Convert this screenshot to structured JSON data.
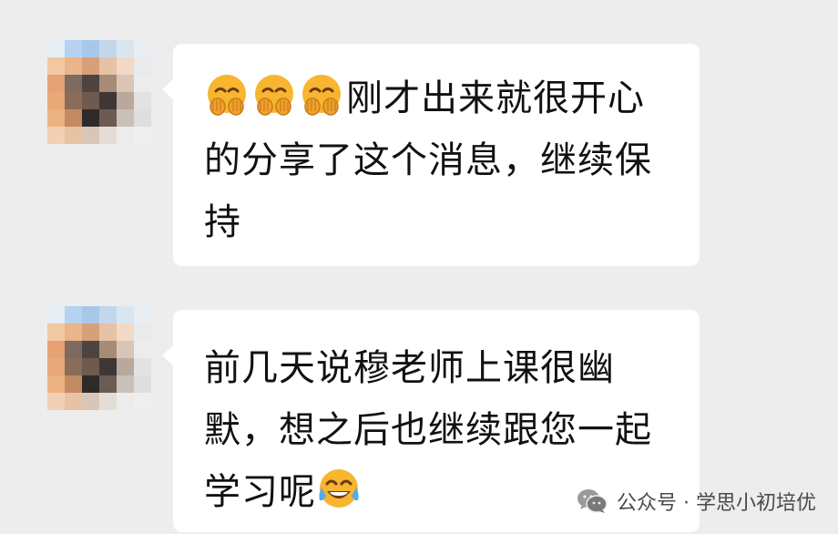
{
  "messages": [
    {
      "emojis": [
        "hands-over-mouth-emoji",
        "hands-over-mouth-emoji",
        "hands-over-mouth-emoji"
      ],
      "text": "刚才出来就很开心的分享了这个消息，继续保持"
    },
    {
      "text": "前几天说穆老师上课很幽默，想之后也继续跟您一起学习呢",
      "trailing_emoji": "tears-of-joy-emoji"
    }
  ],
  "watermark": {
    "text": "公众号 · 学思小初培优",
    "icon": "wechat-icon"
  },
  "colors": {
    "background": "#ededed",
    "bubble": "#ffffff",
    "text": "#111111",
    "emoji_yellow": "#f7b530"
  }
}
